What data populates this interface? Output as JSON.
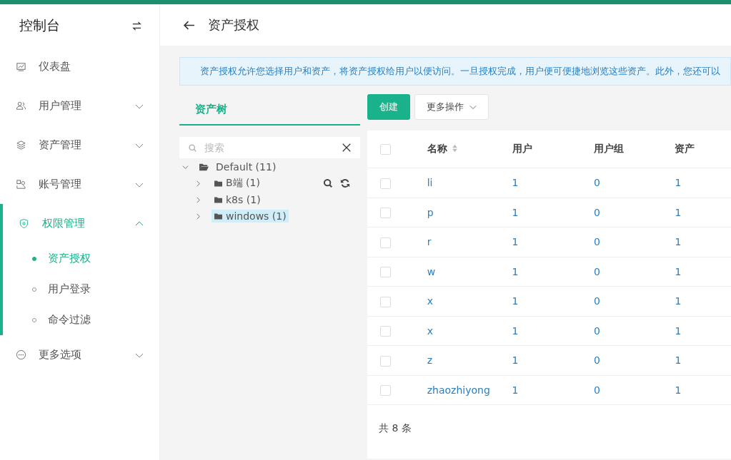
{
  "sidebar": {
    "title": "控制台",
    "items": [
      {
        "label": "仪表盘",
        "selected": false
      },
      {
        "label": "用户管理",
        "expanded": false,
        "selected": false
      },
      {
        "label": "资产管理",
        "expanded": false,
        "selected": false
      },
      {
        "label": "账号管理",
        "expanded": false,
        "selected": false
      },
      {
        "label": "权限管理",
        "expanded": true,
        "selected": true,
        "children": [
          {
            "label": "资产授权",
            "selected": true
          },
          {
            "label": "用户登录",
            "selected": false
          },
          {
            "label": "命令过滤",
            "selected": false
          }
        ]
      },
      {
        "label": "更多选项",
        "expanded": false,
        "selected": false
      }
    ]
  },
  "header": {
    "title": "资产授权"
  },
  "notice": "资产授权允许您选择用户和资产，将资产授权给用户以便访问。一旦授权完成，用户便可便捷地浏览这些资产。此外，您还可以",
  "tree_panel": {
    "tab": "资产树",
    "search": {
      "placeholder": "搜索"
    },
    "tree": [
      {
        "label": "Default (11)",
        "expanded": true,
        "selected": false,
        "children": [
          {
            "label": "B端 (1)",
            "expanded": false,
            "selected": false
          },
          {
            "label": "k8s (1)",
            "expanded": false,
            "selected": false
          },
          {
            "label": "windows (1)",
            "expanded": false,
            "selected": true
          }
        ]
      }
    ]
  },
  "toolbar": {
    "create": "创建",
    "more": "更多操作"
  },
  "table": {
    "select_all_checked": false,
    "columns": [
      "名称",
      "用户",
      "用户组",
      "资产"
    ],
    "rows": [
      {
        "checked": false,
        "cells": [
          "li",
          "1",
          "0",
          "1"
        ]
      },
      {
        "checked": false,
        "cells": [
          "p",
          "1",
          "0",
          "1"
        ]
      },
      {
        "checked": false,
        "cells": [
          "r",
          "1",
          "0",
          "1"
        ]
      },
      {
        "checked": false,
        "cells": [
          "w",
          "1",
          "0",
          "1"
        ]
      },
      {
        "checked": false,
        "cells": [
          "x",
          "1",
          "0",
          "1"
        ]
      },
      {
        "checked": false,
        "cells": [
          "x",
          "1",
          "0",
          "1"
        ]
      },
      {
        "checked": false,
        "cells": [
          "z",
          "1",
          "0",
          "1"
        ]
      },
      {
        "checked": false,
        "cells": [
          "zhaozhiyong",
          "1",
          "0",
          "1"
        ]
      }
    ],
    "total": "共 8 条"
  }
}
